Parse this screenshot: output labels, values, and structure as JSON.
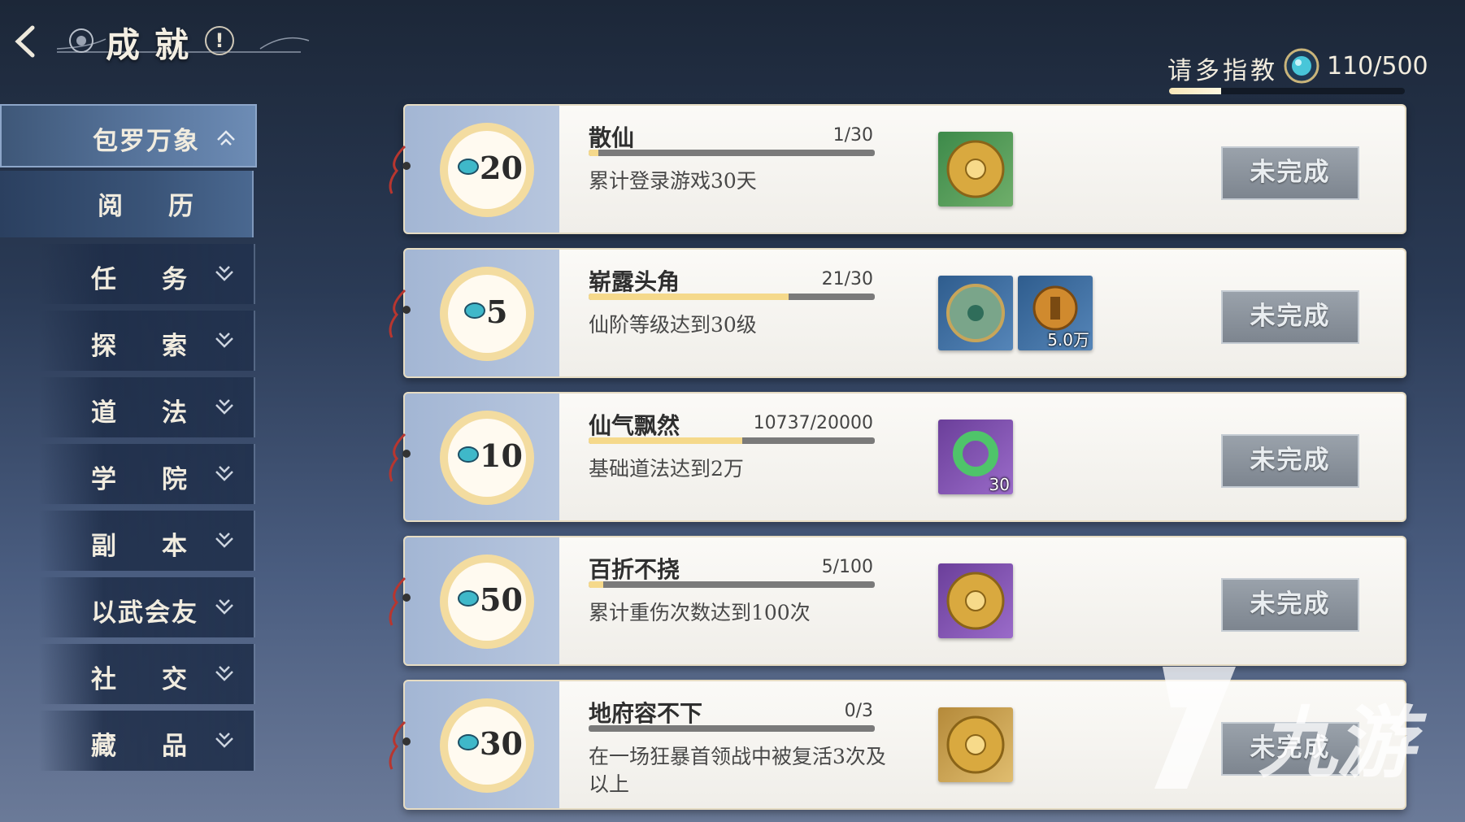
{
  "header": {
    "title": "成就",
    "info_icon": "!"
  },
  "rank": {
    "title": "请多指教",
    "value": "110/500",
    "progress": 0.22
  },
  "sidebar": {
    "items": [
      {
        "label": "包罗万象",
        "icon": "chevron-up",
        "state": "active"
      },
      {
        "label": "阅历",
        "state": "sub-selected"
      },
      {
        "label": "任务",
        "icon": "chevron-down"
      },
      {
        "label": "探索",
        "icon": "chevron-down"
      },
      {
        "label": "道法",
        "icon": "chevron-down"
      },
      {
        "label": "学院",
        "icon": "chevron-down"
      },
      {
        "label": "副本",
        "icon": "chevron-down"
      },
      {
        "label": "以武会友",
        "icon": "chevron-down"
      },
      {
        "label": "社交",
        "icon": "chevron-down"
      },
      {
        "label": "藏品",
        "icon": "chevron-down"
      }
    ]
  },
  "achievements": [
    {
      "points": "20",
      "name": "散仙",
      "progress_text": "1/30",
      "progress": 0.033,
      "desc": "累计登录游戏30天",
      "rewards": [
        {
          "icon": "golden-disc-icon",
          "rarity": "green",
          "count": ""
        }
      ],
      "status": "未完成"
    },
    {
      "points": "5",
      "name": "崭露头角",
      "progress_text": "21/30",
      "progress": 0.7,
      "desc": "仙阶等级达到30级",
      "rewards": [
        {
          "icon": "jade-disc-icon",
          "rarity": "blue",
          "count": ""
        },
        {
          "icon": "coin-icon",
          "rarity": "blue",
          "count": "5.0万"
        }
      ],
      "status": "未完成"
    },
    {
      "points": "10",
      "name": "仙气飘然",
      "progress_text": "10737/20000",
      "progress": 0.537,
      "desc": "基础道法达到2万",
      "rewards": [
        {
          "icon": "jade-ring-icon",
          "rarity": "purple",
          "count": "30"
        }
      ],
      "status": "未完成"
    },
    {
      "points": "50",
      "name": "百折不挠",
      "progress_text": "5/100",
      "progress": 0.05,
      "desc": "累计重伤次数达到100次",
      "rewards": [
        {
          "icon": "golden-disc-icon",
          "rarity": "purple",
          "count": ""
        }
      ],
      "status": "未完成"
    },
    {
      "points": "30",
      "name": "地府容不下",
      "progress_text": "0/3",
      "progress": 0.0,
      "desc": "在一场狂暴首领战中被复活3次及以上",
      "rewards": [
        {
          "icon": "golden-disc-icon",
          "rarity": "gold",
          "count": ""
        }
      ],
      "status": "未完成"
    }
  ],
  "watermark": {
    "text": "九游",
    "icon": "9game-logo-icon"
  },
  "colors": {
    "accent": "#f5d98b",
    "sidebar_active": "#557299",
    "card_bg": "#f5f3ee",
    "status_btn": "#8a929b"
  }
}
